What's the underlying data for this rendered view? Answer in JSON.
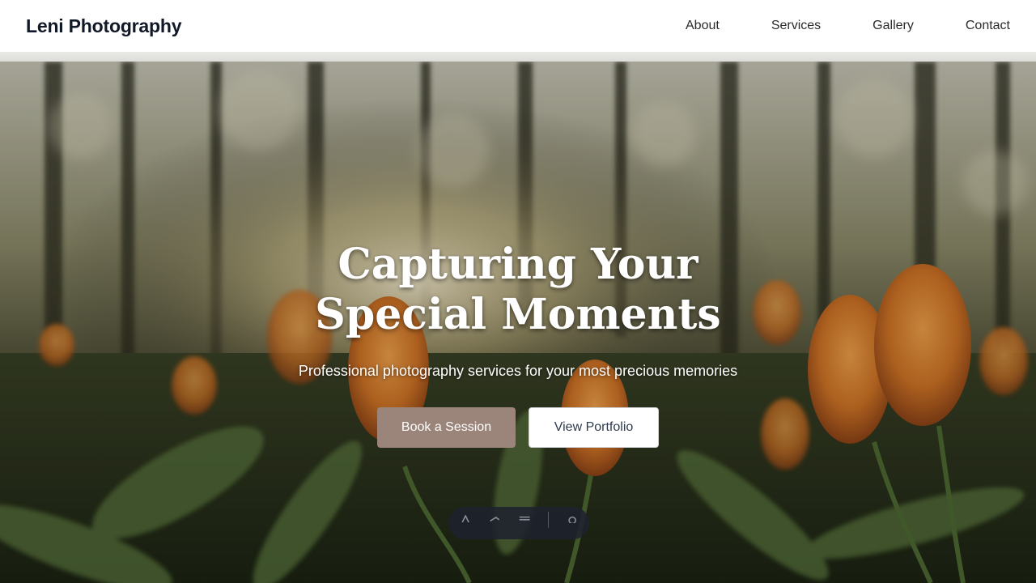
{
  "brand": "Leni Photography",
  "nav": {
    "links": [
      "About",
      "Services",
      "Gallery",
      "Contact"
    ]
  },
  "hero": {
    "title": "Capturing Your Special Moments",
    "subtitle": "Professional photography services for your most precious memories",
    "primary_button": "Book a Session",
    "secondary_button": "View Portfolio"
  },
  "dock": {
    "icons": [
      "text-icon",
      "brush-icon",
      "menu-icon",
      "gear-icon"
    ]
  },
  "colors": {
    "primary_button": "#9b857a",
    "brand_text": "#111827"
  }
}
